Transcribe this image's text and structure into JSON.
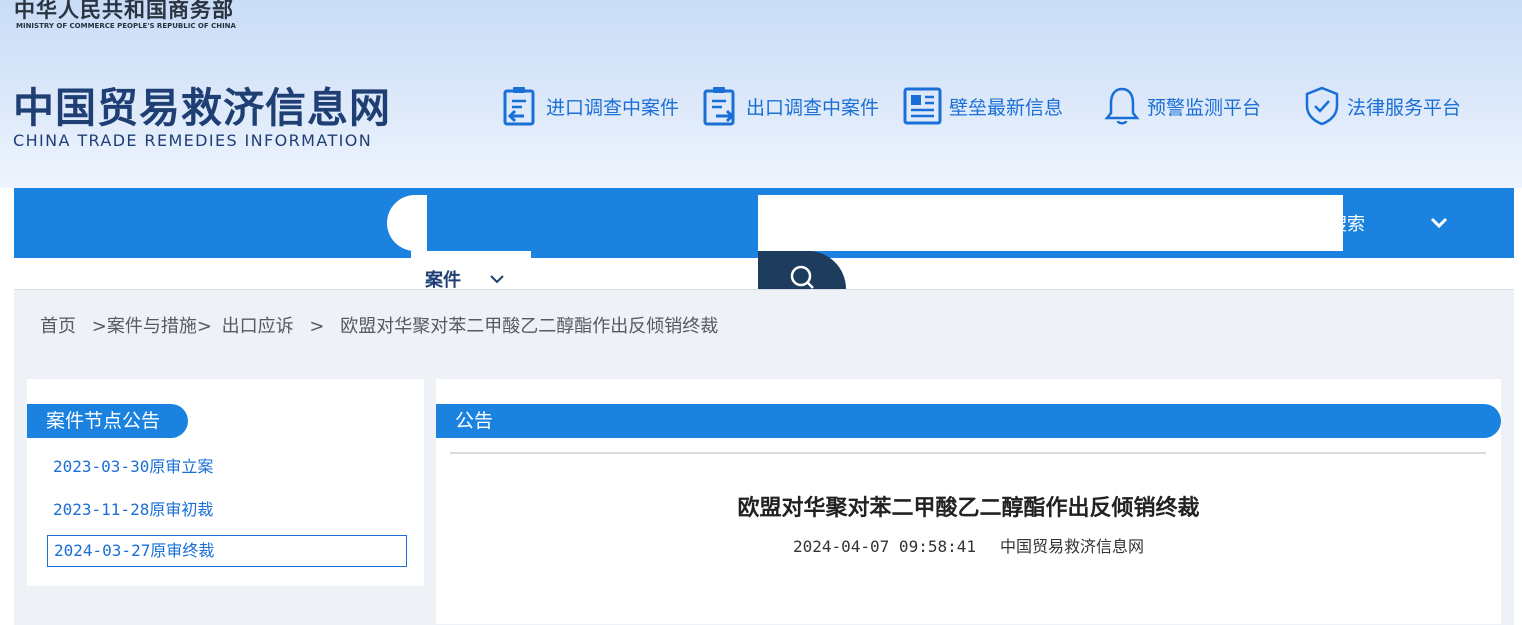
{
  "header": {
    "ministry_cn": "中华人民共和国商务部",
    "ministry_en": "MINISTRY OF COMMERCE PEOPLE'S REPUBLIC OF CHINA",
    "site_cn": "中国贸易救济信息网",
    "site_en": "CHINA TRADE REMEDIES INFORMATION",
    "quick_links": [
      {
        "label": "进口调查中案件",
        "icon": "import-case-icon"
      },
      {
        "label": "出口调查中案件",
        "icon": "export-case-icon"
      },
      {
        "label": "壁垒最新信息",
        "icon": "news-icon"
      },
      {
        "label": "预警监测平台",
        "icon": "bell-icon"
      },
      {
        "label": "法律服务平台",
        "icon": "shield-check-icon"
      }
    ]
  },
  "search": {
    "category": "案件",
    "input_value": "",
    "nav_text": "搜索"
  },
  "breadcrumb": {
    "items": [
      "首页",
      ">案件与措施>",
      "出口应诉",
      ">",
      "欧盟对华聚对苯二甲酸乙二醇酯作出反倾销终裁"
    ]
  },
  "sidebar": {
    "title": "案件节点公告",
    "items": [
      "2023-03-30原审立案",
      "2023-11-28原审初裁",
      "2024-03-27原审终裁"
    ],
    "active_index": 2
  },
  "main": {
    "section_title": "公告",
    "article_title": "欧盟对华聚对苯二甲酸乙二醇酯作出反倾销终裁",
    "datetime": "2024-04-07 09:58:41",
    "source": "中国贸易救济信息网"
  },
  "colors": {
    "primary_blue": "#1b82e0",
    "brand_navy": "#1f3f74",
    "link_blue": "#1a6fd6",
    "search_button": "#1d3c5e"
  }
}
